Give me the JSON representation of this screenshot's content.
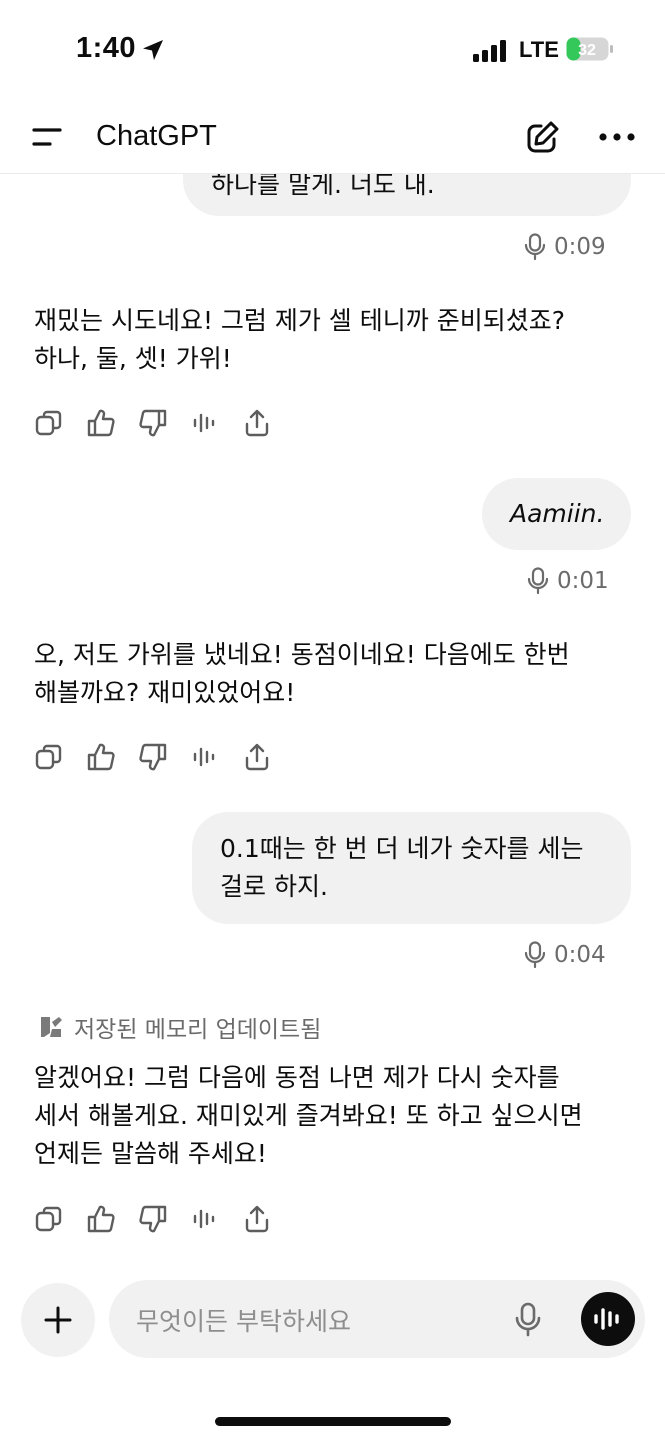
{
  "status_bar": {
    "time": "1:40",
    "network": "LTE",
    "battery": "32"
  },
  "header": {
    "title": "ChatGPT"
  },
  "messages": [
    {
      "role": "user",
      "text": "하나를 말게. 너도 내.",
      "voice_duration": "0:09"
    },
    {
      "role": "assistant",
      "lines": [
        "재밌는 시도네요! 그럼 제가 셀 테니까 준비되셨죠?",
        "하나, 둘, 셋! 가위!"
      ]
    },
    {
      "role": "user",
      "text": "Aamiin.",
      "voice_duration": "0:01"
    },
    {
      "role": "assistant",
      "lines": [
        "오, 저도 가위를 냈네요! 동점이네요! 다음에도 한번",
        "해볼까요? 재미있었어요!"
      ]
    },
    {
      "role": "user",
      "lines": [
        "0.1때는 한 번 더 네가 숫자를 세는",
        "걸로 하지."
      ],
      "voice_duration": "0:04"
    },
    {
      "role": "assistant",
      "memory_note": "저장된 메모리 업데이트됨",
      "lines": [
        "알겠어요! 그럼 다음에 동점 나면 제가 다시 숫자를",
        "세서 해볼게요. 재미있게 즐겨봐요! 또 하고 싶으시면",
        "언제든 말씀해 주세요!"
      ]
    }
  ],
  "composer": {
    "placeholder": "무엇이든 부탁하세요"
  },
  "icons": {
    "actions": [
      "copy-icon",
      "thumbs-up-icon",
      "thumbs-down-icon",
      "read-aloud-icon",
      "share-icon"
    ]
  }
}
